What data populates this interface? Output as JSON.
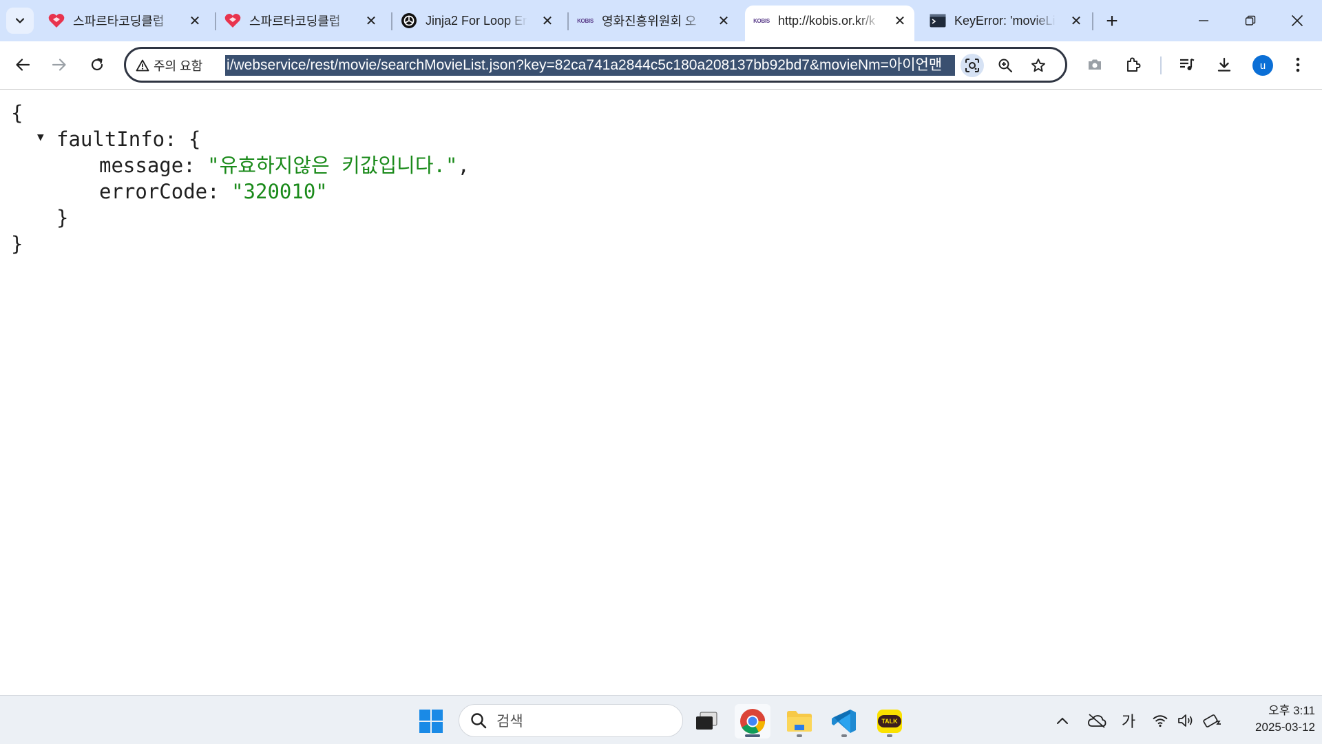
{
  "browser": {
    "tab_search_icon": "chevron-down-icon",
    "tabs": [
      {
        "title": "스파르타코딩클럽",
        "favicon": "sparta-heart-icon",
        "active": false
      },
      {
        "title": "스파르타코딩클럽",
        "favicon": "sparta-heart-icon",
        "active": false
      },
      {
        "title": "Jinja2 For Loop Er",
        "favicon": "openai-icon",
        "active": false
      },
      {
        "title": "영화진흥위원회 오",
        "favicon": "kobis-icon",
        "active": false
      },
      {
        "title": "http://kobis.or.kr/k",
        "favicon": "kobis-icon",
        "active": true
      },
      {
        "title": "KeyError: 'movieLi",
        "favicon": "terminal-icon",
        "active": false
      }
    ],
    "favicon_text": {
      "kobis": "KOBIS"
    },
    "new_tab_label": "+",
    "window_controls": [
      "minimize",
      "restore",
      "close"
    ]
  },
  "toolbar": {
    "security_label": "주의 요함",
    "url_text": "i/webservice/rest/movie/searchMovieList.json?key=82ca741a2844c5c180a208137bb92bd7&movieNm=아이언맨",
    "avatar_letter": "u"
  },
  "json_view": {
    "open_brace": "{",
    "close_brace": "}",
    "object_key": "faultInfo",
    "object_open": ": {",
    "object_close": "}",
    "toggle": "▼",
    "fields": [
      {
        "key": "message",
        "sep": ": ",
        "value": "\"유효하지않은 키값입니다.\"",
        "trail": ","
      },
      {
        "key": "errorCode",
        "sep": ": ",
        "value": "\"320010\"",
        "trail": ""
      }
    ]
  },
  "taskbar": {
    "search_placeholder": "검색",
    "ime_label": "가",
    "kakao_label": "TALK",
    "clock_period_time": "오후 3:11",
    "clock_date": "2025-03-12"
  },
  "colors": {
    "tabstrip_bg": "#d3e3fd",
    "url_highlight": "#3a5070",
    "json_string": "#1a8a1a",
    "taskbar_bg": "#ecf0f5"
  }
}
